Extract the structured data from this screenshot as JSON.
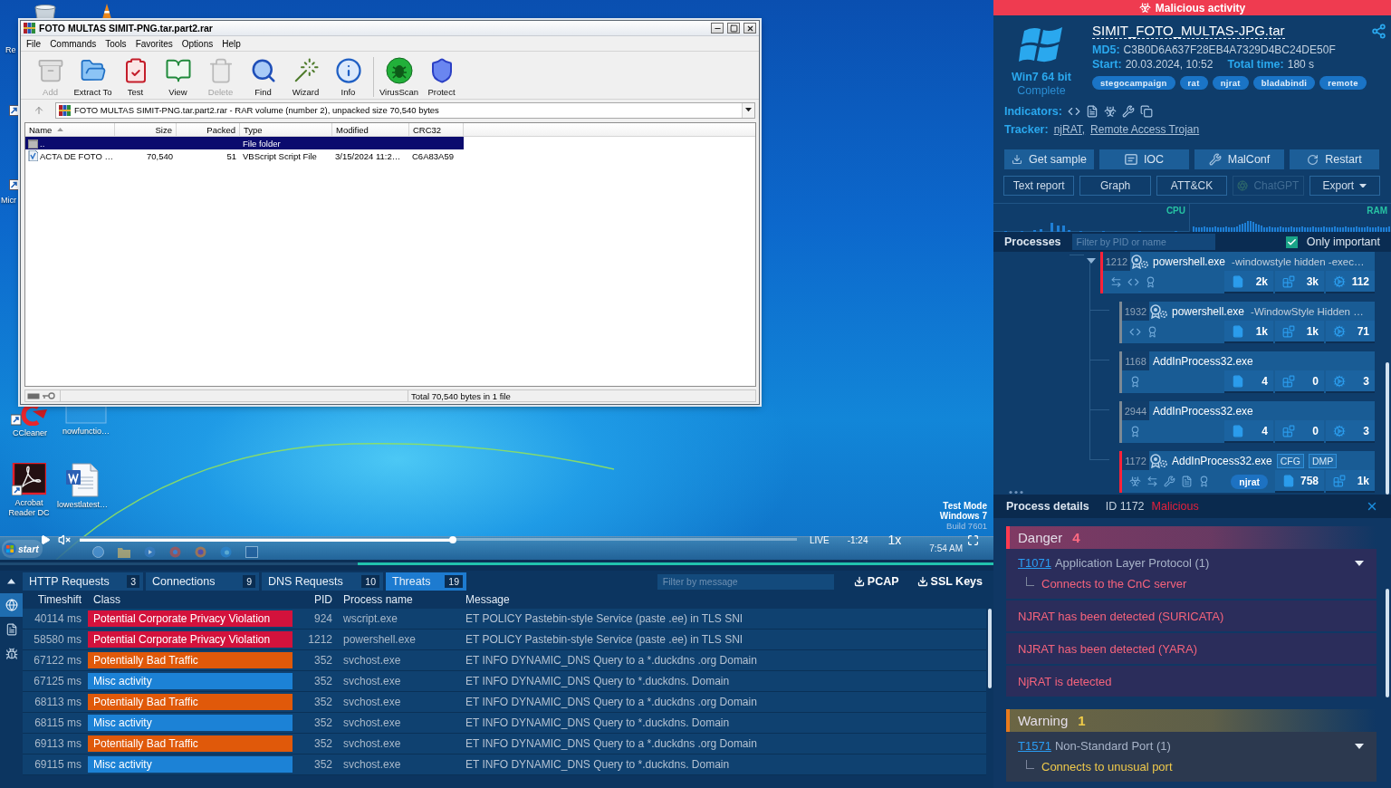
{
  "vm_screen": {
    "desktop_icons": [
      {
        "kind": "bin"
      },
      {
        "kind": "cone"
      },
      {
        "kind": "cut",
        "label": "Re"
      },
      {
        "kind": "shortcut"
      },
      {
        "kind": "shortcut"
      },
      {
        "kind": "cut",
        "label": "Micr"
      },
      {
        "kind": "cleaner",
        "label": "CCleaner"
      },
      {
        "kind": "blank",
        "label": "nowfunctio…"
      },
      {
        "kind": "acrobat",
        "label": "Acrobat Reader DC"
      },
      {
        "kind": "word",
        "label": "lowestlatest…"
      }
    ],
    "os_notice": [
      {
        "kind": "strong",
        "text": "Test Mode"
      },
      {
        "kind": "strong",
        "text": "Windows 7"
      },
      {
        "kind": "faint",
        "text": "Build 7601"
      }
    ],
    "taskbar": {
      "start": "start",
      "clock": "7:54 AM"
    }
  },
  "archive_window": {
    "title": "FOTO MULTAS SIMIT-PNG.tar.part2.rar",
    "menu": [
      "File",
      "Commands",
      "Tools",
      "Favorites",
      "Options",
      "Help"
    ],
    "toolbar": [
      {
        "kind": "add",
        "label": "Add",
        "disabled": true
      },
      {
        "kind": "extract",
        "label": "Extract To",
        "disabled": false
      },
      {
        "kind": "test",
        "label": "Test",
        "disabled": false
      },
      {
        "kind": "view",
        "label": "View",
        "disabled": false
      },
      {
        "kind": "delete",
        "label": "Delete",
        "disabled": true
      },
      {
        "kind": "find",
        "label": "Find",
        "disabled": false
      },
      {
        "kind": "wizard",
        "label": "Wizard",
        "disabled": false
      },
      {
        "kind": "info",
        "label": "Info",
        "disabled": false
      },
      {
        "kind": "virusscan",
        "label": "VirusScan",
        "disabled": false
      },
      {
        "kind": "protect",
        "label": "Protect",
        "disabled": false
      }
    ],
    "path": "FOTO MULTAS SIMIT-PNG.tar.part2.rar - RAR volume (number 2), unpacked size 70,540 bytes",
    "columns": [
      "Name",
      "Size",
      "Packed",
      "Type",
      "Modified",
      "CRC32"
    ],
    "rows": [
      {
        "kind": "folder",
        "name": "..",
        "type": "File folder",
        "selected": true
      },
      {
        "kind": "script",
        "name": "ACTA DE FOTO …",
        "size": "70,540",
        "packed": "51",
        "type": "VBScript Script File",
        "modified": "3/15/2024 11:2…",
        "crc": "C6A83A59",
        "selected": false
      }
    ],
    "status": "Total 70,540 bytes in 1 file"
  },
  "player": {
    "muted": true,
    "progress": {
      "level": 0.52
    },
    "live": "LIVE",
    "remaining": "-1:24",
    "speed": "1x"
  },
  "timeline": {
    "level": 0.64
  },
  "network_panel": {
    "side_tabs": [
      {
        "kind": "globe",
        "selected": true
      },
      {
        "kind": "document",
        "selected": false
      },
      {
        "kind": "bug",
        "selected": false
      }
    ],
    "tabs": [
      {
        "label": "HTTP Requests",
        "count": "3",
        "selected": false
      },
      {
        "label": "Connections",
        "count": "9",
        "selected": false
      },
      {
        "label": "DNS Requests",
        "count": "10",
        "selected": false
      },
      {
        "label": "Threats",
        "count": "19",
        "selected": true
      }
    ],
    "filter": {
      "placeholder": "Filter by message"
    },
    "downloads": [
      "PCAP",
      "SSL Keys"
    ],
    "columns": [
      "Timeshift",
      "Class",
      "PID",
      "Process name",
      "Message"
    ],
    "rows": [
      {
        "timeshift": "40114 ms",
        "class": "Potential Corporate Privacy Violation",
        "color": "#d3123c",
        "pid": "924",
        "process": "wscript.exe",
        "message": "ET POLICY Pastebin-style Service (paste .ee) in TLS SNI"
      },
      {
        "timeshift": "58580 ms",
        "class": "Potential Corporate Privacy Violation",
        "color": "#d3123c",
        "pid": "1212",
        "process": "powershell.exe",
        "message": "ET POLICY Pastebin-style Service (paste .ee) in TLS SNI"
      },
      {
        "timeshift": "67122 ms",
        "class": "Potentially Bad Traffic",
        "color": "#e0590a",
        "pid": "352",
        "process": "svchost.exe",
        "message": "ET INFO DYNAMIC_DNS Query to a *.duckdns .org Domain"
      },
      {
        "timeshift": "67125 ms",
        "class": "Misc activity",
        "color": "#1c82d6",
        "pid": "352",
        "process": "svchost.exe",
        "message": "ET INFO DYNAMIC_DNS Query to *.duckdns. Domain"
      },
      {
        "timeshift": "68113 ms",
        "class": "Potentially Bad Traffic",
        "color": "#e0590a",
        "pid": "352",
        "process": "svchost.exe",
        "message": "ET INFO DYNAMIC_DNS Query to a *.duckdns .org Domain"
      },
      {
        "timeshift": "68115 ms",
        "class": "Misc activity",
        "color": "#1c82d6",
        "pid": "352",
        "process": "svchost.exe",
        "message": "ET INFO DYNAMIC_DNS Query to *.duckdns. Domain"
      },
      {
        "timeshift": "69113 ms",
        "class": "Potentially Bad Traffic",
        "color": "#e0590a",
        "pid": "352",
        "process": "svchost.exe",
        "message": "ET INFO DYNAMIC_DNS Query to a *.duckdns .org Domain"
      },
      {
        "timeshift": "69115 ms",
        "class": "Misc activity",
        "color": "#1c82d6",
        "pid": "352",
        "process": "svchost.exe",
        "message": "ET INFO DYNAMIC_DNS Query to *.duckdns. Domain"
      }
    ]
  },
  "report": {
    "verdict": "Malicious activity",
    "os": "Win7 64 bit",
    "status": "Complete",
    "file_name": "SIMIT_FOTO_MULTAS-JPG.tar",
    "md5_label": "MD5:",
    "md5": "C3B0D6A637F28EB4A7329D4BC24DE50F",
    "start_label": "Start:",
    "start": "20.03.2024, 10:52",
    "total_label": "Total time:",
    "total": "180 s",
    "tags": [
      "stegocampaign",
      "rat",
      "njrat",
      "bladabindi",
      "remote"
    ],
    "indicators_label": "Indicators:",
    "indicators": [
      {
        "kind": "code"
      },
      {
        "kind": "document"
      },
      {
        "kind": "biohazard"
      },
      {
        "kind": "tools"
      },
      {
        "kind": "windows"
      }
    ],
    "tracker_label": "Tracker:",
    "trackers": [
      "njRAT,",
      "Remote Access Trojan"
    ],
    "actions": [
      {
        "kind": "download",
        "label": "Get sample"
      },
      {
        "kind": "ioc",
        "label": "IOC"
      },
      {
        "kind": "tools",
        "label": "MalConf"
      },
      {
        "kind": "restart",
        "label": "Restart"
      }
    ],
    "reports": [
      {
        "kind": "plain",
        "label": "Text report",
        "disabled": false
      },
      {
        "kind": "plain",
        "label": "Graph",
        "disabled": false
      },
      {
        "kind": "plain",
        "label": "ATT&CK",
        "disabled": false
      },
      {
        "kind": "ai",
        "label": "ChatGPT",
        "disabled": true
      },
      {
        "kind": "menu",
        "label": "Export",
        "disabled": false
      }
    ],
    "monitors": [
      "CPU",
      "RAM"
    ]
  },
  "processes": {
    "title": "Processes",
    "filter": {
      "placeholder": "Filter by PID or name"
    },
    "only_important": {
      "label": "Only important",
      "checked": true
    },
    "tree": [
      {
        "pid": "1212",
        "kind": "gears",
        "name": "powershell.exe",
        "args": "-windowstyle hidden -exec…",
        "malicious": true,
        "expanded": true,
        "flags": [
          {
            "kind": "network"
          },
          {
            "kind": "code"
          },
          {
            "kind": "badge"
          }
        ],
        "stats": {
          "files": "2k",
          "registry": "3k",
          "modules": "112"
        },
        "children": [
          {
            "pid": "1932",
            "kind": "gears",
            "name": "powershell.exe",
            "args": "-WindowStyle Hidden …",
            "malicious": false,
            "flags": [
              {
                "kind": "code"
              },
              {
                "kind": "badge"
              }
            ],
            "stats": {
              "files": "1k",
              "registry": "1k",
              "modules": "71"
            }
          },
          {
            "pid": "1168",
            "kind": "plain",
            "name": "AddInProcess32.exe",
            "malicious": false,
            "flags": [
              {
                "kind": "badge"
              }
            ],
            "stats": {
              "files": "4",
              "registry": "0",
              "modules": "3"
            }
          },
          {
            "pid": "2944",
            "kind": "plain",
            "name": "AddInProcess32.exe",
            "malicious": false,
            "flags": [
              {
                "kind": "badge"
              }
            ],
            "stats": {
              "files": "4",
              "registry": "0",
              "modules": "3"
            }
          },
          {
            "pid": "1172",
            "kind": "gears",
            "name": "AddInProcess32.exe",
            "tags": [
              "CFG",
              "DMP"
            ],
            "malicious": true,
            "flags": [
              {
                "kind": "biohazard"
              },
              {
                "kind": "network"
              },
              {
                "kind": "tools"
              },
              {
                "kind": "document"
              },
              {
                "kind": "badge"
              }
            ],
            "label": "njrat",
            "stats": {
              "files": "758",
              "registry": "1k"
            }
          }
        ]
      }
    ]
  },
  "process_details": {
    "title": "Process details",
    "id": "ID 1172",
    "verdict": "Malicious",
    "groups": [
      {
        "kind": "danger",
        "title": "Danger",
        "count": "4",
        "items": [
          {
            "kind": "technique",
            "technique": "T1071",
            "name": "Application Layer Protocol (1)",
            "expanded": true,
            "detail": "Connects to the CnC server"
          },
          {
            "kind": "signature",
            "text": "NJRAT has been detected (SURICATA)"
          },
          {
            "kind": "signature",
            "text": "NJRAT has been detected (YARA)"
          },
          {
            "kind": "signature",
            "text": "NjRAT is detected"
          }
        ]
      },
      {
        "kind": "warning",
        "title": "Warning",
        "count": "1",
        "items": [
          {
            "kind": "technique",
            "technique": "T1571",
            "name": "Non-Standard Port (1)",
            "expanded": true,
            "detail": "Connects to unusual port"
          }
        ]
      }
    ]
  }
}
